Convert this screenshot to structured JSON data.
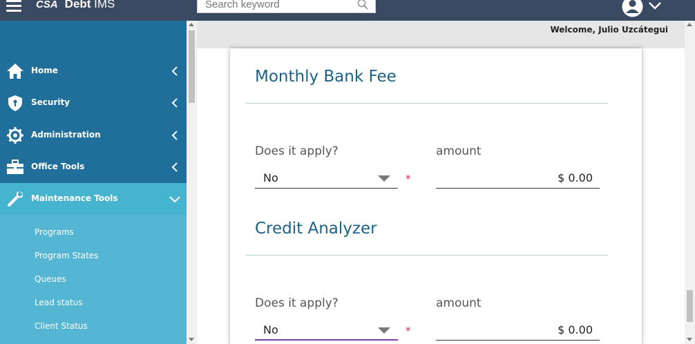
{
  "header": {
    "logo_text": "CSA",
    "app_name_bold": "Debt",
    "app_name_rest": " IMS",
    "search_placeholder": "Search keyword",
    "search_value": ""
  },
  "welcome_text": "Welcome, Julio Uzcátegui",
  "sidebar": {
    "items": [
      {
        "label": "Home",
        "icon": "home-icon"
      },
      {
        "label": "Security",
        "icon": "shield-icon"
      },
      {
        "label": "Administration",
        "icon": "gear-icon"
      },
      {
        "label": "Office Tools",
        "icon": "toolbox-icon"
      },
      {
        "label": "Maintenance Tools",
        "icon": "wrench-icon",
        "expanded": true
      }
    ],
    "submenu": [
      "Programs",
      "Program States",
      "Queues",
      "Lead status",
      "Client Status"
    ]
  },
  "sections": [
    {
      "title": "Monthly Bank Fee",
      "apply_label": "Does it apply?",
      "apply_value": "No",
      "required_mark": "*",
      "amount_label": "amount",
      "amount_value": "$ 0.00"
    },
    {
      "title": "Credit Analyzer",
      "apply_label": "Does it apply?",
      "apply_value": "No",
      "required_mark": "*",
      "amount_label": "amount",
      "amount_value": "$ 0.00"
    }
  ],
  "colors": {
    "topbar": "#3b4a63",
    "sidebar": "#1f6f9a",
    "sidebar_active": "#46b3cf",
    "submenu": "#55b6d3",
    "section_title": "#1a6288",
    "required": "#e0304a"
  }
}
